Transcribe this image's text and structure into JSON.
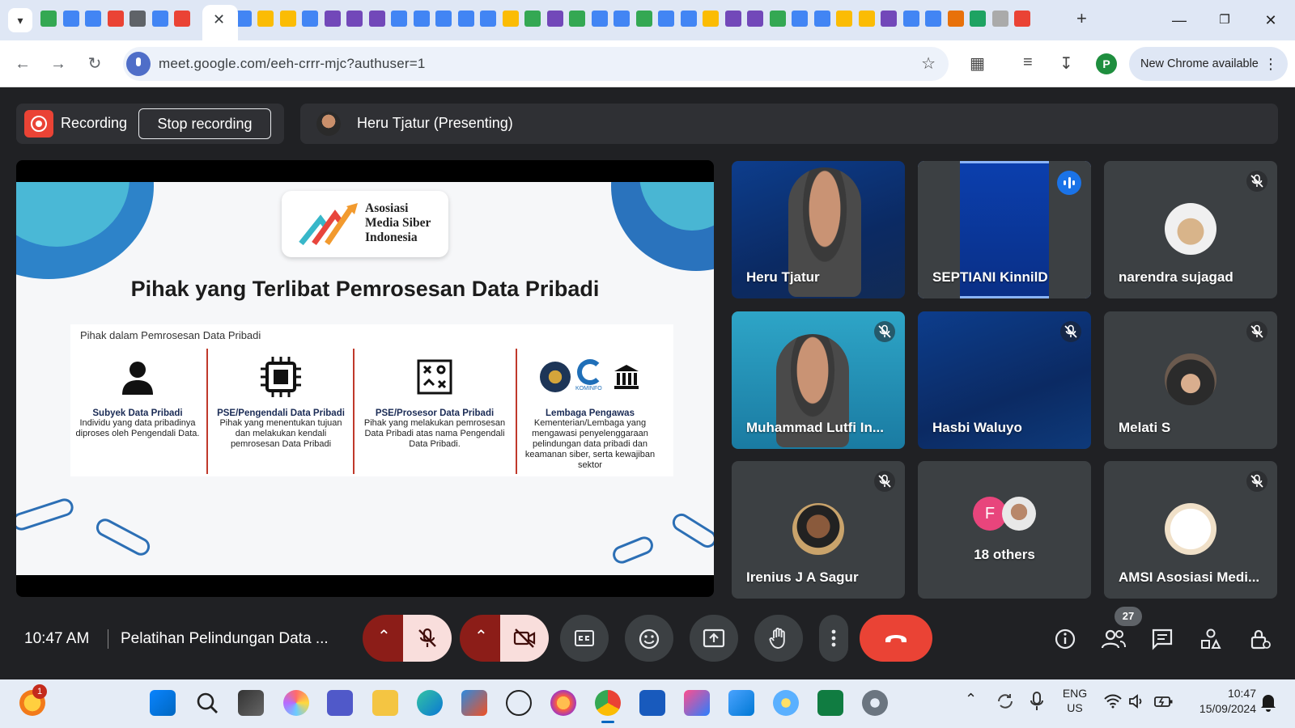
{
  "browser": {
    "address": "meet.google.com/eeh-crrr-mjc?authuser=1",
    "profile_initial": "P",
    "update_label": "New Chrome available",
    "favicon_colors": [
      "#34a853",
      "#4285f4",
      "#4285f4",
      "#ea4335",
      "#5f6368",
      "#4285f4",
      "#ea4335",
      "#4285f4",
      "#fbbc04",
      "#fbbc04",
      "#4285f4",
      "#7248b9",
      "#7248b9",
      "#7248b9",
      "#4285f4",
      "#4285f4",
      "#4285f4",
      "#4285f4",
      "#4285f4",
      "#fbbc04",
      "#34a853",
      "#7248b9",
      "#34a853",
      "#4285f4",
      "#4285f4",
      "#34a853",
      "#4285f4",
      "#4285f4",
      "#fbbc04",
      "#7248b9",
      "#7248b9",
      "#34a853",
      "#4285f4",
      "#4285f4",
      "#fbbc04",
      "#fbbc04",
      "#7248b9",
      "#4285f4",
      "#4285f4",
      "#e8710a",
      "#1ea362",
      "#aaaaaa",
      "#ea4335"
    ]
  },
  "recording": {
    "label": "Recording",
    "stop_label": "Stop recording"
  },
  "presenter": {
    "label": "Heru Tjatur (Presenting)"
  },
  "slide": {
    "logo_lines": [
      "Asosiasi",
      "Media Siber",
      "Indonesia"
    ],
    "title": "Pihak yang Terlibat Pemrosesan Data Pribadi",
    "section_heading": "Pihak dalam Pemrosesan Data Pribadi",
    "kominfo_label": "KOMINFO",
    "columns": [
      {
        "title": "Subyek Data Pribadi",
        "desc": "Individu yang data pribadinya diproses oleh Pengendali Data."
      },
      {
        "title": "PSE/Pengendali Data Pribadi",
        "desc": "Pihak yang menentukan tujuan dan melakukan kendali pemrosesan Data Pribadi"
      },
      {
        "title": "PSE/Prosesor Data Pribadi",
        "desc": "Pihak yang melakukan pemrosesan Data Pribadi atas nama Pengendali Data Pribadi."
      },
      {
        "title": "Lembaga Pengawas",
        "desc": "Kementerian/Lembaga yang mengawasi penyelenggaraan pelindungan data pribadi dan keamanan siber, serta kewajiban sektor"
      }
    ]
  },
  "participants": [
    {
      "name": "Heru Tjatur",
      "muted": false,
      "speaking": false
    },
    {
      "name": "SEPTIANI KinnilD",
      "muted": false,
      "speaking": true
    },
    {
      "name": "narendra sujagad",
      "muted": true,
      "speaking": false
    },
    {
      "name": "Muhammad Lutfi In...",
      "muted": true,
      "speaking": false
    },
    {
      "name": "Hasbi Waluyo",
      "muted": true,
      "speaking": false
    },
    {
      "name": "Melati S",
      "muted": true,
      "speaking": false
    },
    {
      "name": "Irenius J A Sagur",
      "muted": true,
      "speaking": false
    },
    {
      "name": "18 others",
      "initial": "F",
      "muted": false,
      "speaking": false
    },
    {
      "name": "AMSI Asosiasi Medi...",
      "muted": true,
      "speaking": false
    }
  ],
  "meeting": {
    "time": "10:47 AM",
    "title": "Pelatihan Pelindungan Data ...",
    "participant_count": "27"
  },
  "taskbar": {
    "notification_count": "1",
    "lang_top": "ENG",
    "lang_bottom": "US",
    "time": "10:47",
    "date": "15/09/2024"
  }
}
